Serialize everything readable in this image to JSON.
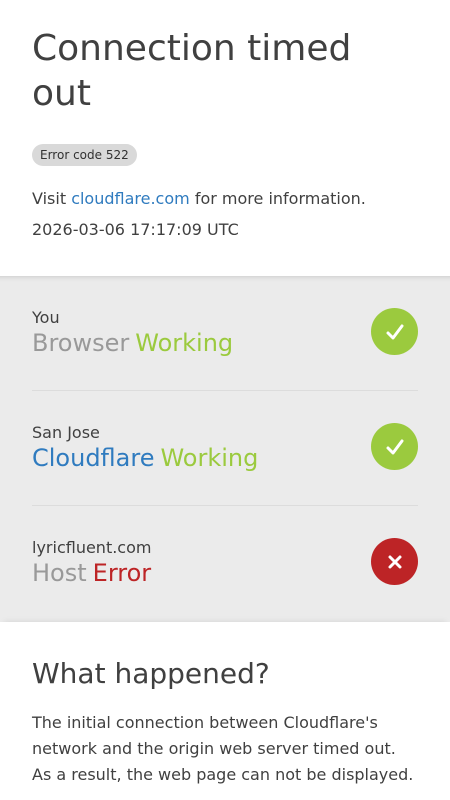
{
  "header": {
    "title": "Connection timed out",
    "error_badge": "Error code 522",
    "visit_prefix": "Visit ",
    "visit_link": "cloudflare.com",
    "visit_suffix": " for more information.",
    "timestamp": "2026-03-06 17:17:09 UTC"
  },
  "status": {
    "rows": [
      {
        "location": "You",
        "name": "Browser",
        "state": "Working",
        "ok": true
      },
      {
        "location": "San Jose",
        "name": "Cloudflare",
        "state": "Working",
        "ok": true
      },
      {
        "location": "lyricfluent.com",
        "name": "Host",
        "state": "Error",
        "ok": false
      }
    ]
  },
  "footer": {
    "heading": "What happened?",
    "body": "The initial connection between Cloudflare's network and the origin web server timed out. As a result, the web page can not be displayed."
  },
  "colors": {
    "ok": "#9bca3e",
    "error": "#bd2426",
    "link": "#2f7bbf"
  },
  "icons": {
    "ok": "checkmark-icon",
    "error": "x-icon"
  }
}
